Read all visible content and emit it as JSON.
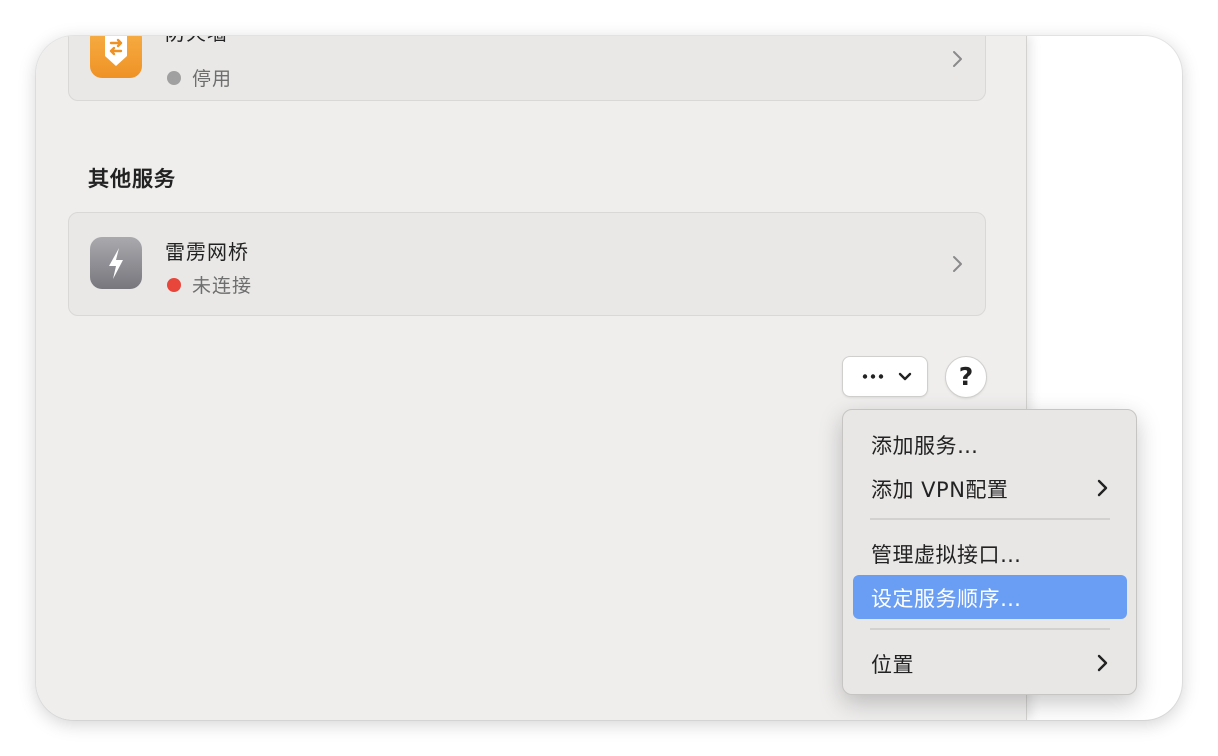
{
  "settings": {
    "firewall": {
      "title": "防火墙",
      "status": "停用",
      "status_color": "#a0a0a0",
      "icon": "firewall-shield-icon"
    },
    "other_services": {
      "heading": "其他服务",
      "items": [
        {
          "title": "雷雳网桥",
          "status": "未连接",
          "status_color": "#e8463b",
          "icon": "thunderbolt-bridge-icon"
        }
      ]
    },
    "toolbar": {
      "more_button": "ellipsis-chevron-down-icon",
      "help_label": "?"
    }
  },
  "context_menu": {
    "items": [
      {
        "label": "添加服务…",
        "has_submenu": false,
        "highlighted": false
      },
      {
        "label": "添加 VPN配置",
        "has_submenu": true,
        "highlighted": false
      },
      {
        "label": "管理虚拟接口…",
        "has_submenu": false,
        "highlighted": false
      },
      {
        "label": "设定服务顺序…",
        "has_submenu": false,
        "highlighted": true
      },
      {
        "label": "位置",
        "has_submenu": true,
        "highlighted": false
      }
    ],
    "highlight_color": "#6a9ef5"
  }
}
